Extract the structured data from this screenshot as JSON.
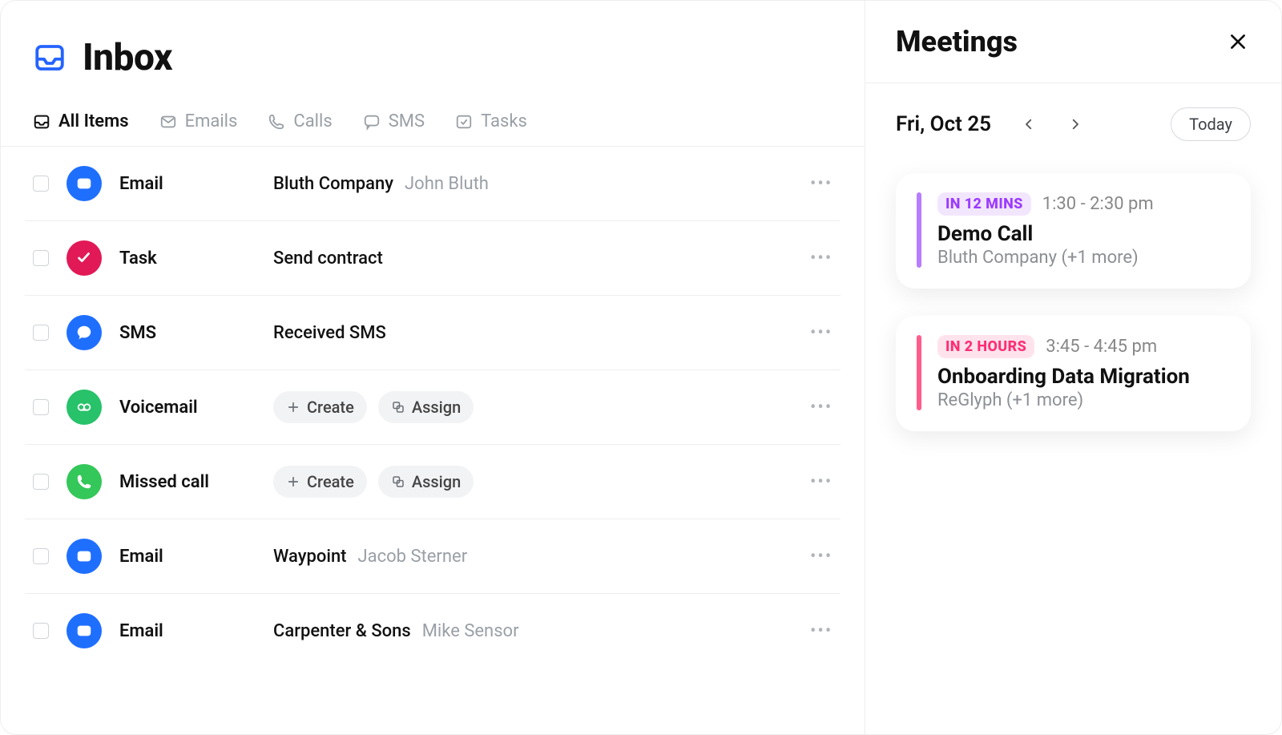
{
  "header": {
    "title": "Inbox"
  },
  "tabs": [
    {
      "label": "All Items",
      "active": true
    },
    {
      "label": "Emails",
      "active": false
    },
    {
      "label": "Calls",
      "active": false
    },
    {
      "label": "SMS",
      "active": false
    },
    {
      "label": "Tasks",
      "active": false
    }
  ],
  "actions": {
    "create": "Create",
    "assign": "Assign"
  },
  "rows": [
    {
      "type": "Email",
      "primary": "Bluth Company",
      "secondary": "John Bluth",
      "buttons": false
    },
    {
      "type": "Task",
      "primary": "Send contract",
      "secondary": "",
      "buttons": false
    },
    {
      "type": "SMS",
      "primary": "Received SMS",
      "secondary": "",
      "buttons": false
    },
    {
      "type": "Voicemail",
      "primary": "",
      "secondary": "",
      "buttons": true
    },
    {
      "type": "Missed call",
      "primary": "",
      "secondary": "",
      "buttons": true
    },
    {
      "type": "Email",
      "primary": "Waypoint",
      "secondary": "Jacob Sterner",
      "buttons": false
    },
    {
      "type": "Email",
      "primary": "Carpenter & Sons",
      "secondary": "Mike Sensor",
      "buttons": false
    }
  ],
  "meetings": {
    "title": "Meetings",
    "date": "Fri, Oct 25",
    "today": "Today",
    "events": [
      {
        "badge": "IN 12 MINS",
        "time": "1:30 - 2:30 pm",
        "title": "Demo Call",
        "subtitle": "Bluth Company (+1 more)",
        "color": "purple"
      },
      {
        "badge": "IN 2 HOURS",
        "time": "3:45 - 4:45 pm",
        "title": "Onboarding Data Migration",
        "subtitle": "ReGlyph (+1 more)",
        "color": "pink"
      }
    ]
  }
}
